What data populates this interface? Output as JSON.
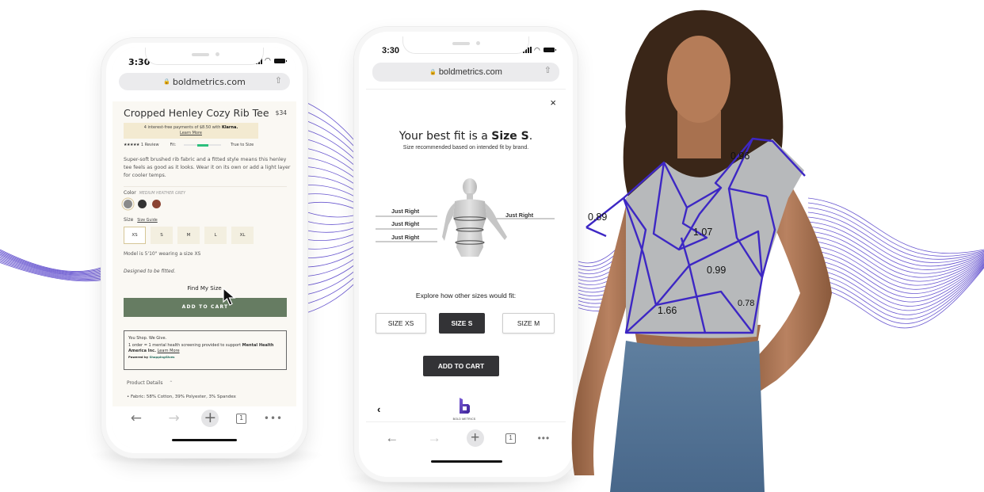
{
  "phone_left": {
    "status": {
      "time": "3:30"
    },
    "url": "boldmetrics.com",
    "product": {
      "title": "Cropped Henley Cozy Rib Tee",
      "price": "$34",
      "klarna_text": "4 interest-free payments of $8.50 with",
      "klarna_brand": "Klarna.",
      "klarna_link": "Learn More",
      "stars": "★★★★★",
      "reviews": "1 Review",
      "fit_label": "Fit:",
      "fit_value": "True to Size",
      "fit_position_fraction": 0.5,
      "description": "Super-soft brushed rib fabric and a fitted style means this henley tee feels as good as it looks. Wear it on its own or add a light layer for cooler temps.",
      "color_label": "Color",
      "color_value": "MEDIUM HEATHER GREY",
      "swatches": [
        {
          "name": "Medium Heather Grey",
          "hex": "#8a8a8a",
          "selected": true
        },
        {
          "name": "Black",
          "hex": "#333333",
          "selected": false
        },
        {
          "name": "Brown",
          "hex": "#8b4433",
          "selected": false
        }
      ],
      "size_label": "Size",
      "size_guide": "Size Guide",
      "sizes": [
        {
          "label": "XS",
          "selected": true
        },
        {
          "label": "S",
          "selected": false
        },
        {
          "label": "M",
          "selected": false
        },
        {
          "label": "L",
          "selected": false
        },
        {
          "label": "XL",
          "selected": false
        }
      ],
      "model_note": "Model is 5'10\" wearing a size XS",
      "fitted_note": "Designed to be fitted.",
      "find_my_size": "Find My Size",
      "add_to_cart": "ADD TO CART",
      "give_title": "You Shop. We Give.",
      "give_text": "1 order = 1 mental health screening provided to support",
      "give_org": "Mental Health America Inc.",
      "give_link": "Learn More",
      "powered_by": "Powered by",
      "powered_brand": "ShoppingGives",
      "details_label": "Product Details",
      "fabric": "Fabric: 58% Cotton, 39% Polyester, 3% Spandex"
    },
    "toolbar": {
      "tabs_count": "1"
    }
  },
  "phone_right": {
    "status": {
      "time": "3:30"
    },
    "url": "boldmetrics.com",
    "close": "×",
    "best_fit_prefix": "Your best fit is a",
    "best_fit_size": "Size S",
    "best_fit_suffix": ".",
    "subtitle": "Size recommended based on intended fit by brand.",
    "fit_labels": [
      "Just Right",
      "Just Right",
      "Just Right",
      "Just Right"
    ],
    "explore": "Explore how other sizes would fit:",
    "size_options": [
      {
        "label": "SIZE XS",
        "selected": false
      },
      {
        "label": "SIZE S",
        "selected": true
      },
      {
        "label": "SIZE M",
        "selected": false
      }
    ],
    "add_to_cart": "ADD TO CART",
    "back": "‹",
    "logo_text": "BOLD METRICS",
    "toolbar": {
      "tabs_count": "1"
    }
  },
  "measurements": [
    "0.96",
    "0.89",
    "1.07",
    "0.99",
    "1.66",
    "0.78"
  ],
  "accent_colors": {
    "wave": "#5b47c8",
    "mesh": "#3d27c4",
    "atc_green": "#667c62",
    "dark_button": "#333336"
  }
}
